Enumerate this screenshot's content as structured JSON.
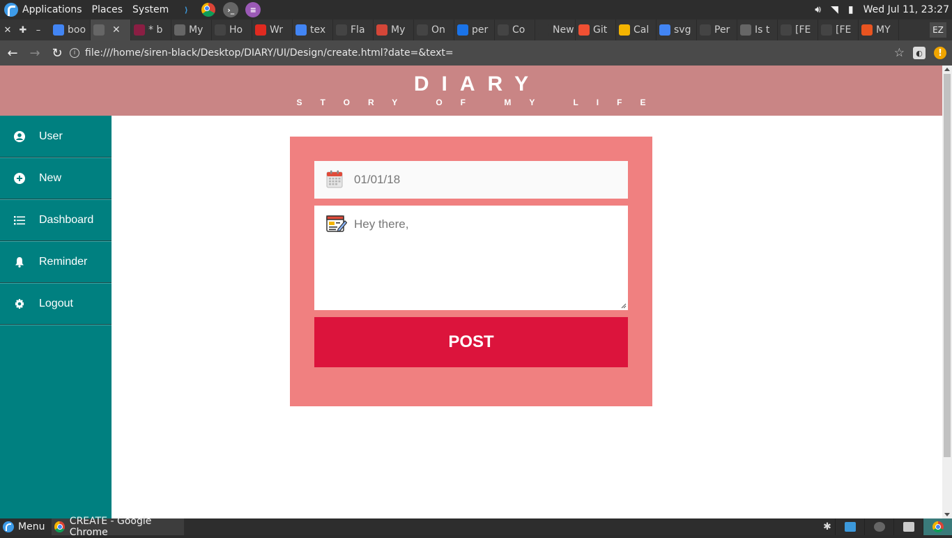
{
  "panel": {
    "applications": "Applications",
    "places": "Places",
    "system": "System",
    "clock": "Wed Jul 11, 23:27"
  },
  "tabs": [
    {
      "label": "boo",
      "favicon": "google-icon",
      "color": "#4285f4"
    },
    {
      "label": "",
      "favicon": "page-icon",
      "color": "#666666"
    },
    {
      "label": "* b",
      "favicon": "slack-icon",
      "color": "#8a1e43"
    },
    {
      "label": "My",
      "favicon": "page-icon",
      "color": "#666666"
    },
    {
      "label": "Ho",
      "favicon": "github-icon",
      "color": "#444444"
    },
    {
      "label": "Wr",
      "favicon": "pinterest-icon",
      "color": "#e02a20"
    },
    {
      "label": "tex",
      "favicon": "google-icon",
      "color": "#4285f4"
    },
    {
      "label": "Fla",
      "favicon": "github-icon",
      "color": "#444444"
    },
    {
      "label": "My",
      "favicon": "gmail-icon",
      "color": "#d44638"
    },
    {
      "label": "On",
      "favicon": "github-icon",
      "color": "#444444"
    },
    {
      "label": "per",
      "favicon": "flag-icon",
      "color": "#1a73e8"
    },
    {
      "label": "Co",
      "favicon": "github-icon",
      "color": "#444444"
    },
    {
      "label": "New T",
      "favicon": "",
      "color": "#353535"
    },
    {
      "label": "Git",
      "favicon": "git-icon",
      "color": "#f05033"
    },
    {
      "label": "Cal",
      "favicon": "calendar-icon",
      "color": "#f4b400"
    },
    {
      "label": "svg",
      "favicon": "google-icon",
      "color": "#4285f4"
    },
    {
      "label": "Per",
      "favicon": "github-icon",
      "color": "#444444"
    },
    {
      "label": "Is t",
      "favicon": "page-icon",
      "color": "#666666"
    },
    {
      "label": "[FE",
      "favicon": "github-icon",
      "color": "#444444"
    },
    {
      "label": "[FE",
      "favicon": "github-icon",
      "color": "#444444"
    },
    {
      "label": "MY",
      "favicon": "ubuntu-icon",
      "color": "#e95420"
    }
  ],
  "tab_profile": "EZ",
  "address_bar": {
    "url": "file:///home/siren-black/Desktop/DIARY/UI/Design/create.html?date=&text="
  },
  "site": {
    "title": "DIARY",
    "subtitle": "STORY OF MY LIFE"
  },
  "sidebar": {
    "items": [
      {
        "label": "User",
        "icon": "user-circle-icon"
      },
      {
        "label": "New",
        "icon": "plus-circle-icon"
      },
      {
        "label": "Dashboard",
        "icon": "list-icon"
      },
      {
        "label": "Reminder",
        "icon": "bell-icon"
      },
      {
        "label": "Logout",
        "icon": "gear-icon"
      }
    ]
  },
  "form": {
    "date_value": "01/01/18",
    "text_value": "Hey there,",
    "post_label": "POST"
  },
  "taskbar": {
    "menu": "Menu",
    "window_title": "CREATE - Google Chrome"
  },
  "colors": {
    "header": "#c98585",
    "sidebar": "#008080",
    "card": "#f08080",
    "post_button": "#dc143c"
  }
}
